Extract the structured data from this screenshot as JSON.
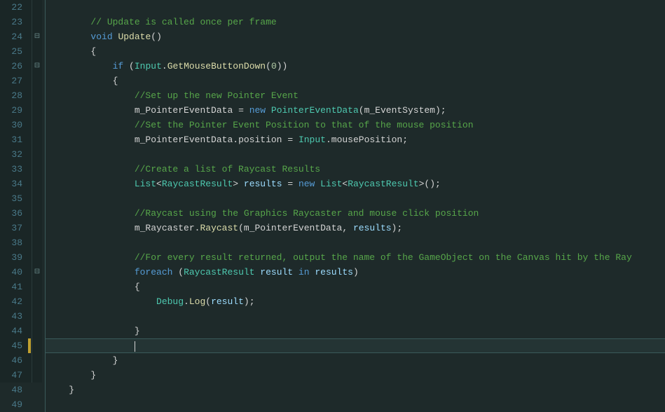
{
  "lineNumbers": [
    "22",
    "23",
    "24",
    "25",
    "26",
    "27",
    "28",
    "29",
    "30",
    "31",
    "32",
    "33",
    "34",
    "35",
    "36",
    "37",
    "38",
    "39",
    "40",
    "41",
    "42",
    "43",
    "44",
    "45",
    "46",
    "47",
    "48",
    "49"
  ],
  "fold": {
    "l24": "⊟",
    "l26": "⊟",
    "l40": "⊟"
  },
  "code": {
    "c23": "// Update is called once per frame",
    "kw_void": "void",
    "m_update": "Update",
    "kw_if": "if",
    "id_Input": "Input",
    "m_gmbd": "GetMouseButtonDown",
    "num_0": "0",
    "c28": "//Set up the new Pointer Event",
    "f_ped": "m_PointerEventData",
    "kw_new": "new",
    "t_ped": "PointerEventData",
    "f_es": "m_EventSystem",
    "c30": "//Set the Pointer Event Position to that of the mouse position",
    "p_position": "position",
    "p_mousePosition": "mousePosition",
    "c33": "//Create a list of Raycast Results",
    "t_list": "List",
    "t_rr": "RaycastResult",
    "v_results": "results",
    "c36": "//Raycast using the Graphics Raycaster and mouse click position",
    "f_rc": "m_Raycaster",
    "m_raycast": "Raycast",
    "c39": "//For every result returned, output the name of the GameObject on the Canvas hit by the Ray",
    "kw_foreach": "foreach",
    "v_result": "result",
    "kw_in": "in",
    "id_Debug": "Debug",
    "m_log": "Log"
  }
}
